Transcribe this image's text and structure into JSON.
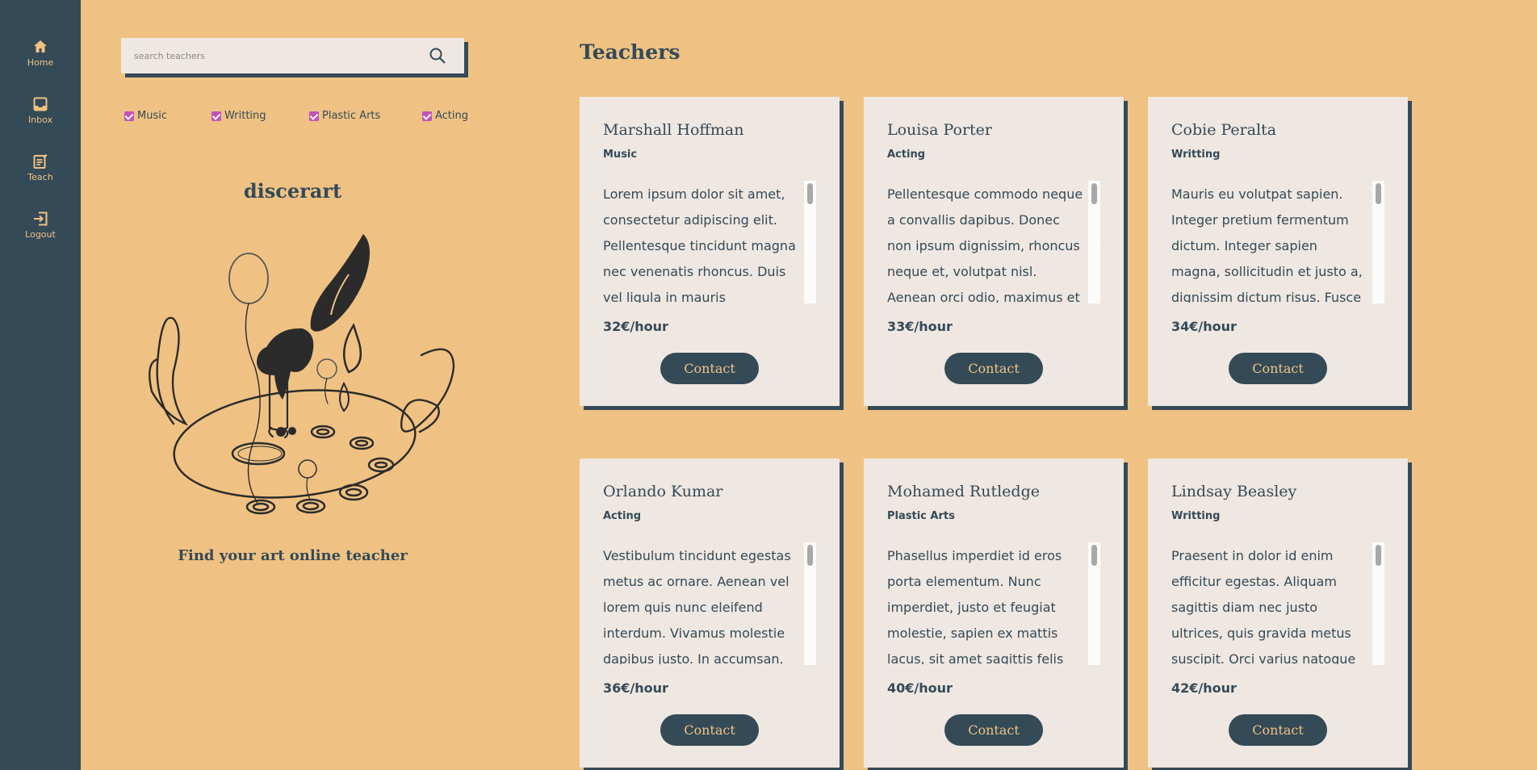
{
  "nav": {
    "items": [
      {
        "label": "Home",
        "icon": "home-icon"
      },
      {
        "label": "Inbox",
        "icon": "inbox-icon"
      },
      {
        "label": "Teach",
        "icon": "teach-icon"
      },
      {
        "label": "Logout",
        "icon": "logout-icon"
      }
    ]
  },
  "search": {
    "placeholder": "search teachers",
    "value": ""
  },
  "filters": [
    {
      "label": "Music",
      "checked": true
    },
    {
      "label": "Writting",
      "checked": true
    },
    {
      "label": "Plastic Arts",
      "checked": true
    },
    {
      "label": "Acting",
      "checked": true
    }
  ],
  "brand": {
    "name": "discerart",
    "tagline": "Find your art online teacher"
  },
  "section_title": "Teachers",
  "teachers": [
    {
      "name": "Marshall Hoffman",
      "category": "Music",
      "description": "Lorem ipsum dolor sit amet, consectetur adipiscing elit. Pellentesque tincidunt magna nec venenatis rhoncus. Duis vel ligula in mauris consectetur",
      "price": "32€/hour",
      "contact_label": "Contact"
    },
    {
      "name": "Louisa Porter",
      "category": "Acting",
      "description": "Pellentesque commodo neque a convallis dapibus. Donec non ipsum dignissim, rhoncus neque et, volutpat nisl. Aenean orci odio, maximus et metus vitae.",
      "price": "33€/hour",
      "contact_label": "Contact"
    },
    {
      "name": "Cobie Peralta",
      "category": "Writting",
      "description": "Mauris eu volutpat sapien. Integer pretium fermentum dictum. Integer sapien magna, sollicitudin et justo a, dignissim dictum risus. Fusce euismod",
      "price": "34€/hour",
      "contact_label": "Contact"
    },
    {
      "name": "Orlando Kumar",
      "category": "Acting",
      "description": "Vestibulum tincidunt egestas metus ac ornare. Aenean vel lorem quis nunc eleifend interdum. Vivamus molestie dapibus justo. In accumsan.",
      "price": "36€/hour",
      "contact_label": "Contact"
    },
    {
      "name": "Mohamed Rutledge",
      "category": "Plastic Arts",
      "description": "Phasellus imperdiet id eros porta elementum. Nunc imperdiet, justo et feugiat molestie, sapien ex mattis lacus, sit amet sagittis felis est ut nunc. Nam in rhoncus eros.",
      "price": "40€/hour",
      "contact_label": "Contact"
    },
    {
      "name": "Lindsay Beasley",
      "category": "Writting",
      "description": "Praesent in dolor id enim efficitur egestas. Aliquam sagittis diam nec justo ultrices, quis gravida metus suscipit. Orci varius natoque penatibus et magnis dis",
      "price": "42€/hour",
      "contact_label": "Contact"
    }
  ],
  "colors": {
    "background": "#efc283",
    "sidebar": "#344a57",
    "card": "#efe7e1",
    "accent_text": "#efc283",
    "checkbox": "#c053b8"
  }
}
